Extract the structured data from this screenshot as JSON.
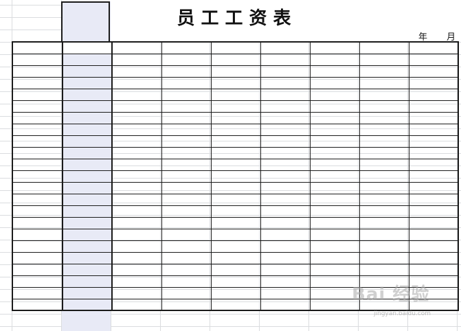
{
  "sheet": {
    "title": "员工工资表",
    "date_year_label": "年",
    "date_month_label": "月"
  },
  "table": {
    "columns": 9,
    "rows": 23
  },
  "watermark": {
    "text": "Bai 经验",
    "sub": "jingyan.baidu.com"
  },
  "colors": {
    "selected_column": "#e8eaf6",
    "grid_line": "#1a1a1a",
    "background_grid": "#dadcdf"
  }
}
